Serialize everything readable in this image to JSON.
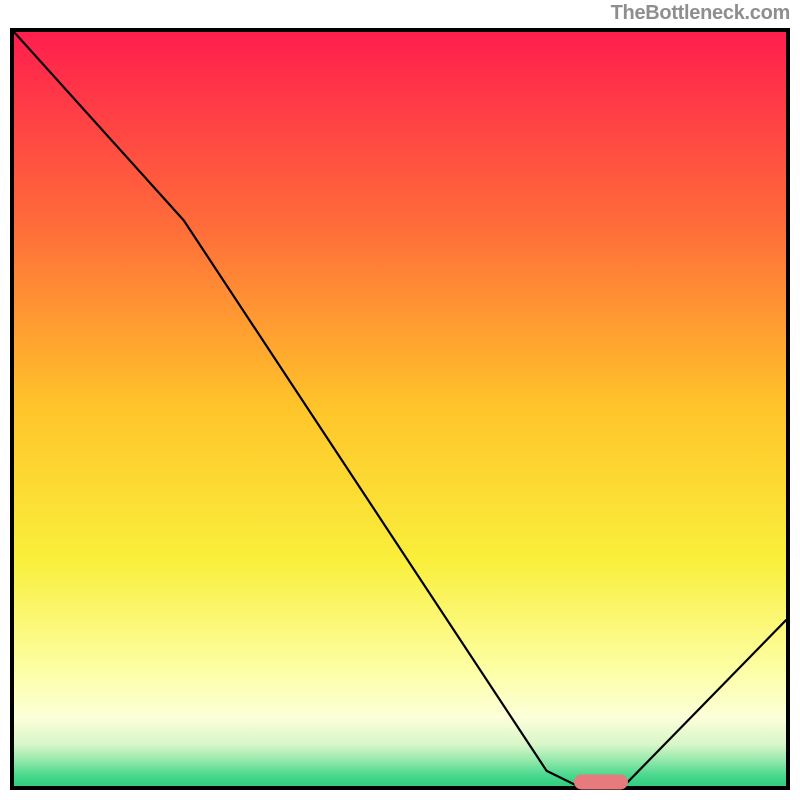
{
  "watermark": "TheBottleneck.com",
  "chart_data": {
    "type": "line",
    "title": "",
    "xlabel": "",
    "ylabel": "",
    "x_range": [
      0,
      100
    ],
    "y_range": [
      0,
      100
    ],
    "series": [
      {
        "name": "bottleneck-curve",
        "x": [
          0,
          22,
          69,
          73,
          79,
          100
        ],
        "y": [
          100,
          75,
          2,
          0,
          0,
          22
        ]
      }
    ],
    "optimal_marker": {
      "x": 76,
      "y": 0
    },
    "gradient_stops": [
      {
        "offset": 0,
        "color": "#ff1e4e"
      },
      {
        "offset": 0.25,
        "color": "#ff6a3a"
      },
      {
        "offset": 0.5,
        "color": "#ffc52a"
      },
      {
        "offset": 0.7,
        "color": "#f9ef3b"
      },
      {
        "offset": 0.85,
        "color": "#fdffa7"
      },
      {
        "offset": 0.91,
        "color": "#fcffd9"
      },
      {
        "offset": 0.945,
        "color": "#d8f6c8"
      },
      {
        "offset": 0.965,
        "color": "#98e9ad"
      },
      {
        "offset": 0.985,
        "color": "#4cd98e"
      },
      {
        "offset": 1.0,
        "color": "#2fce80"
      }
    ]
  }
}
